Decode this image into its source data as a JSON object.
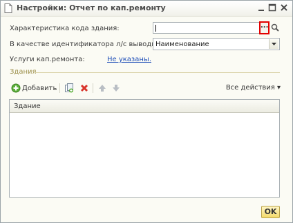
{
  "window": {
    "title": "Настройки: Отчет по кап.ремонту",
    "controls": [
      "minimize",
      "maximize",
      "close"
    ]
  },
  "form": {
    "building_code_label": "Характеристика кода здания:",
    "building_code_value": "",
    "identifier_label": "В качестве идентификатора л/с выводить:",
    "identifier_value": "Наименование",
    "services_label": "Услуги кап.ремонта:",
    "services_link": "Не указаны."
  },
  "group": {
    "title": "Здания"
  },
  "toolbar": {
    "add_label": "Добавить",
    "all_actions_label": "Все действия ▾"
  },
  "table": {
    "columns": [
      "Здание"
    ],
    "rows": []
  },
  "buttons": {
    "ok_label": "OK"
  },
  "colors": {
    "highlight": "#e30000",
    "link": "#1f4fb8",
    "group_title": "#9c8f4a",
    "ok_button": "#f3d96a"
  }
}
